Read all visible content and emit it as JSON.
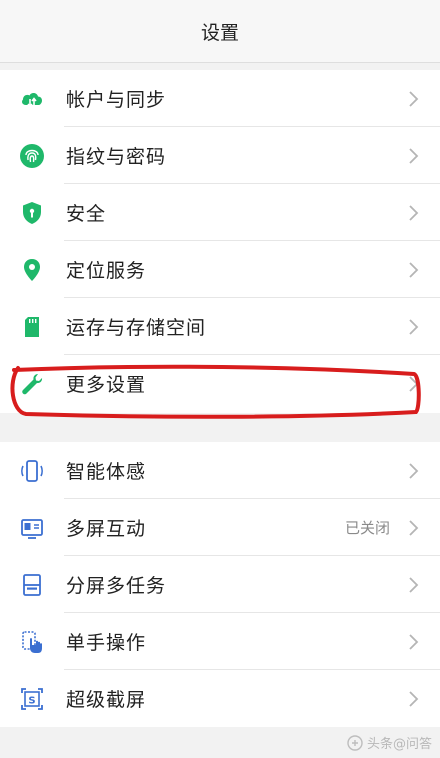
{
  "header": {
    "title": "设置"
  },
  "groups": [
    {
      "items": [
        {
          "label": "帐户与同步",
          "icon": "cloud-sync-icon"
        },
        {
          "label": "指纹与密码",
          "icon": "fingerprint-icon"
        },
        {
          "label": "安全",
          "icon": "shield-icon"
        },
        {
          "label": "定位服务",
          "icon": "location-pin-icon"
        },
        {
          "label": "运存与存储空间",
          "icon": "sd-card-icon"
        },
        {
          "label": "更多设置",
          "icon": "wrench-icon"
        }
      ]
    },
    {
      "items": [
        {
          "label": "智能体感",
          "icon": "motion-phone-icon"
        },
        {
          "label": "多屏互动",
          "icon": "multiscreen-icon",
          "value": "已关闭"
        },
        {
          "label": "分屏多任务",
          "icon": "split-screen-icon"
        },
        {
          "label": "单手操作",
          "icon": "one-hand-icon"
        },
        {
          "label": "超级截屏",
          "icon": "screenshot-icon"
        }
      ]
    }
  ],
  "watermark": {
    "text": "头条@问答"
  },
  "colors": {
    "accent_green": "#1fb86a",
    "accent_blue": "#3b6fd1",
    "highlight_red": "#d81d1d"
  }
}
